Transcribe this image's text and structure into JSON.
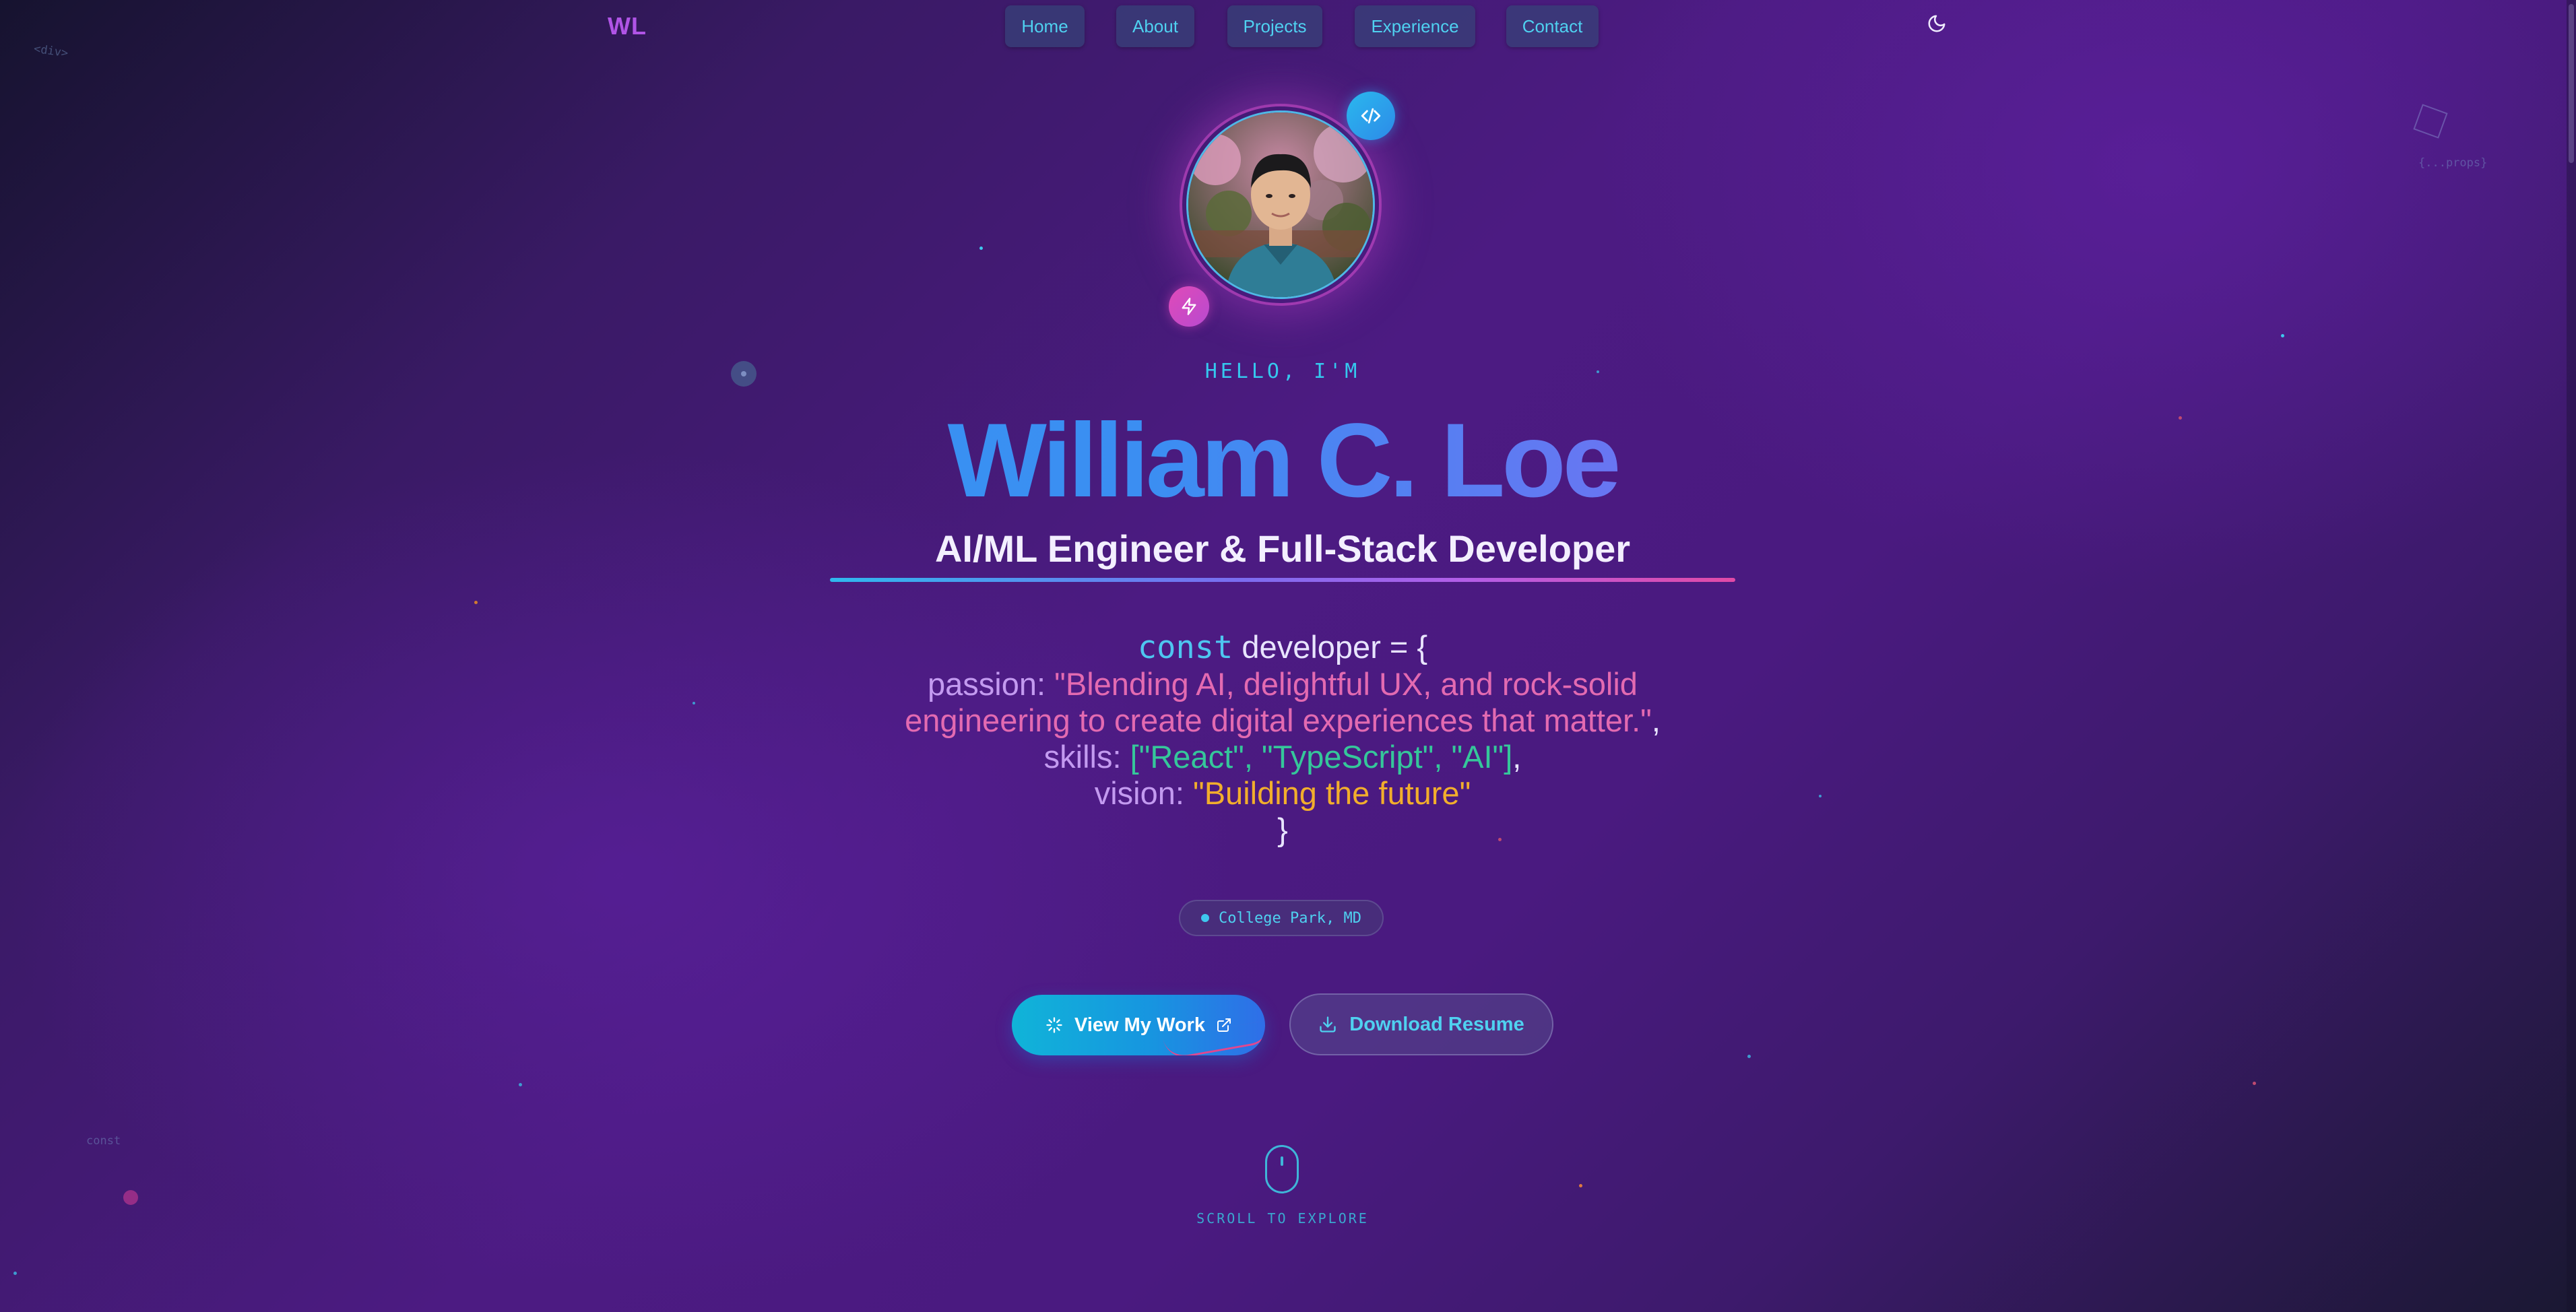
{
  "brand": {
    "logo": "WL"
  },
  "nav": {
    "items": [
      {
        "label": "Home"
      },
      {
        "label": "About"
      },
      {
        "label": "Projects"
      },
      {
        "label": "Experience"
      },
      {
        "label": "Contact"
      }
    ],
    "theme_toggle_icon": "moon-icon"
  },
  "decor": {
    "fragments": [
      "<div>",
      "{...props}",
      "const"
    ]
  },
  "hero": {
    "greeting": "HELLO, I'M",
    "name": "William C. Loe",
    "title": "AI/ML Engineer & Full-Stack Developer",
    "code": {
      "keyword": "const",
      "declaration": "developer = {",
      "passion_key": "passion:",
      "passion_value": "\"Blending AI, delightful UX, and rock-solid engineering to create digital experiences that matter.\"",
      "skills_key": "skills:",
      "skills_value": "[\"React\", \"TypeScript\", \"AI\"]",
      "vision_key": "vision:",
      "vision_value": "\"Building the future\"",
      "closing": "}",
      "comma": ","
    },
    "location": "College Park, MD",
    "badges": {
      "top": "code-icon",
      "bottom": "zap-icon"
    }
  },
  "actions": {
    "primary": {
      "label": "View My Work",
      "icon": "sparkles-icon",
      "trailing_icon": "external-link-icon"
    },
    "secondary": {
      "label": "Download Resume",
      "icon": "download-icon"
    }
  },
  "scroll": {
    "label": "SCROLL TO EXPLORE"
  },
  "colors": {
    "accent_cyan": "#4fd1f0",
    "logo_purple": "#b054e6",
    "name_gradient_start": "#2f9bf0",
    "name_gradient_end": "#9168f4",
    "string_pink": "#e36ab1",
    "string_green": "#35c79a",
    "string_orange": "#f2ae2c"
  }
}
